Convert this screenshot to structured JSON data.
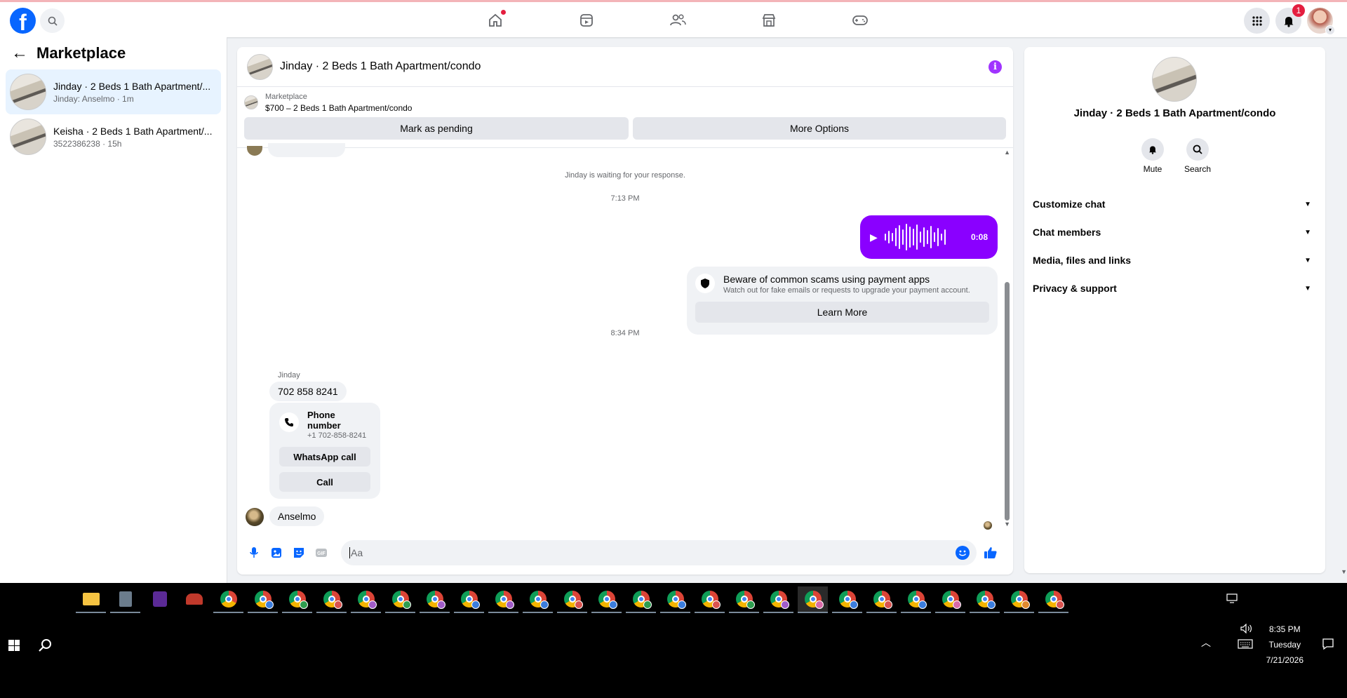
{
  "nav": {
    "logo": "f",
    "tabs": [
      "home-icon",
      "video-icon",
      "friends-icon",
      "marketplace-icon",
      "gaming-icon"
    ],
    "notifications_count": "1"
  },
  "sidebar": {
    "title": "Marketplace",
    "conversations": [
      {
        "name": "Jinday · 2 Beds 1 Bath Apartment/...",
        "sub": "Jinday: Anselmo · 1m"
      },
      {
        "name": "Keisha · 2 Beds 1 Bath Apartment/...",
        "sub": "3522386238 · 15h"
      }
    ]
  },
  "chat": {
    "title": "Jinday · 2 Beds 1 Bath Apartment/condo",
    "listing": {
      "label": "Marketplace",
      "price_line": "$700 – 2 Beds 1 Bath Apartment/condo",
      "mark_pending": "Mark as pending",
      "more_options": "More Options"
    },
    "waiting_note": "Jinday is waiting for your response.",
    "time_1": "7:13 PM",
    "voice_duration": "0:08",
    "scam": {
      "title": "Beware of common scams using payment apps",
      "subtitle": "Watch out for fake emails or requests to upgrade your payment account.",
      "learn_more": "Learn More"
    },
    "time_2": "8:34 PM",
    "sender": "Jinday",
    "phone_message": "702 858 8241",
    "phone_card": {
      "title": "Phone number",
      "number": "+1 702-858-8241",
      "whatsapp": "WhatsApp call",
      "call": "Call"
    },
    "last_message": "Anselmo",
    "composer_placeholder": "Aa"
  },
  "right_panel": {
    "title": "Jinday · 2 Beds 1 Bath Apartment/condo",
    "mute": "Mute",
    "search": "Search",
    "sections": [
      "Customize chat",
      "Chat members",
      "Media, files and links",
      "Privacy & support"
    ]
  },
  "taskbar": {
    "time": "8:35 PM",
    "day": "Tuesday",
    "date": "7/21/2026"
  },
  "colors": {
    "accent": "#0866ff",
    "voice_bubble": "#8a00ff",
    "info": "#a033ff",
    "badge": "#e41e3f"
  }
}
